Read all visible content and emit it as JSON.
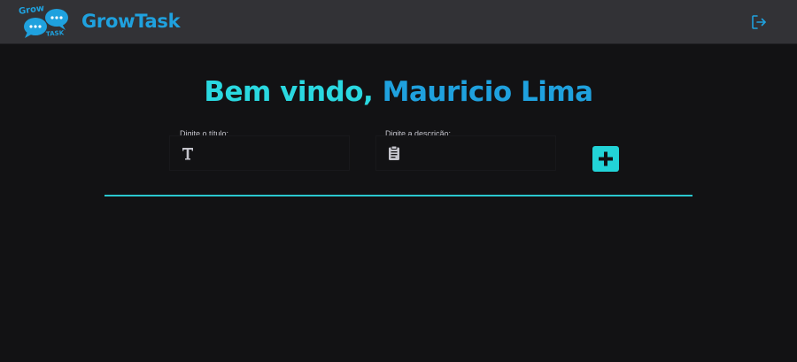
{
  "header": {
    "logo": {
      "word_top": "Grow",
      "word_bottom": "TASK",
      "icon": "chat-bubbles-logo"
    },
    "brand": "GrowTask",
    "logout_icon": "logout-icon"
  },
  "welcome": {
    "greeting": "Bem vindo, ",
    "user_name": "Mauricio Lima"
  },
  "form": {
    "title_label": "Digite o título:",
    "title_value": "",
    "title_icon": "text-t-icon",
    "description_label": "Digite a descrição:",
    "description_value": "",
    "description_icon": "clipboard-icon",
    "add_icon": "plus-icon"
  },
  "colors": {
    "accent_cyan": "#2ad8e0",
    "accent_blue": "#1fa1de",
    "background": "#121214",
    "header": "#323236"
  }
}
